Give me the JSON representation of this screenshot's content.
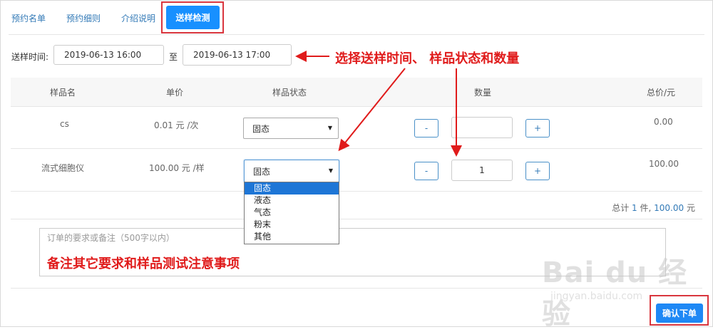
{
  "tabs": [
    {
      "label": "预约名单"
    },
    {
      "label": "预约细则"
    },
    {
      "label": "介绍说明"
    },
    {
      "label": "送样检测",
      "active": true
    }
  ],
  "time": {
    "label": "送样时间:",
    "start": "2019-06-13 16:00",
    "to": "至",
    "end": "2019-06-13 17:00"
  },
  "table": {
    "headers": [
      "样品名",
      "单价",
      "样品状态",
      "数量",
      "总价/元"
    ],
    "rows": [
      {
        "name": "cs",
        "price": "0.01 元 /次",
        "state": "固态",
        "qty": "",
        "total": "0.00"
      },
      {
        "name": "流式细胞仪",
        "price": "100.00 元 /样",
        "state": "固态",
        "qty": "1",
        "total": "100.00"
      }
    ],
    "minus": "-",
    "plus": "+"
  },
  "state_options": [
    "固态",
    "液态",
    "气态",
    "粉末",
    "其他"
  ],
  "summary": {
    "prefix": "总计",
    "count": "1",
    "unit": "件,",
    "amount": "100.00",
    "currency": "元"
  },
  "remark": {
    "placeholder": "订单的要求或备注（500字以内）"
  },
  "confirm": {
    "label": "确认下单"
  },
  "annotations": {
    "top": "选择送样时间、  样品状态和数量",
    "remark": "备注其它要求和样品测试注意事项"
  },
  "watermark": {
    "logo": "Bai du 经验",
    "url": "jingyan.baidu.com"
  },
  "colors": {
    "accent": "#1890ff",
    "annotation": "#e01b1b",
    "link": "#337ab7"
  }
}
